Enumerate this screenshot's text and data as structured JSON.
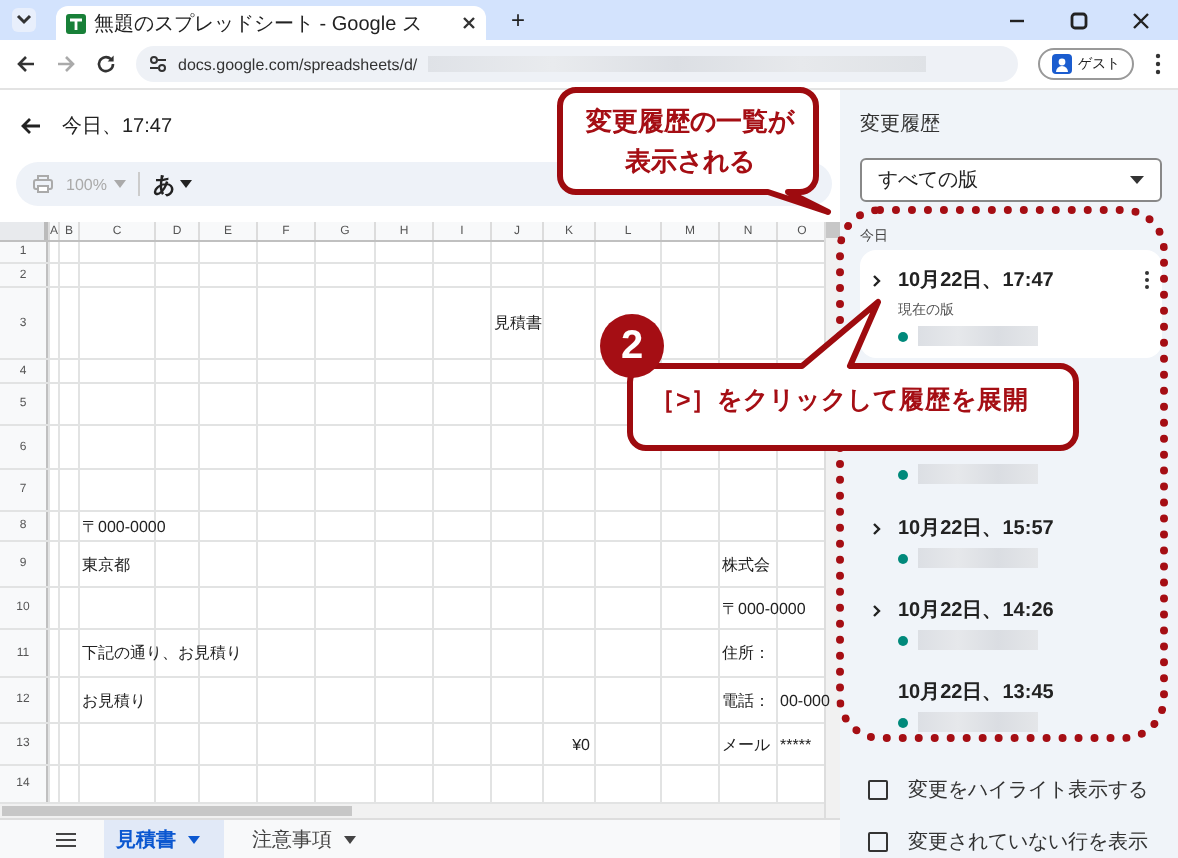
{
  "browser": {
    "tab_title": "無題のスプレッドシート - Google ス",
    "new_tab": "+",
    "url": "docs.google.com/spreadsheets/d/",
    "profile": "ゲスト"
  },
  "header": {
    "title": "今日、17:47"
  },
  "toolbar": {
    "zoom": "100%",
    "zoom_disabled": true,
    "input_mode": "あ"
  },
  "columns": [
    "A",
    "B",
    "C",
    "D",
    "E",
    "F",
    "G",
    "H",
    "I",
    "J",
    "K",
    "L",
    "M",
    "N",
    "O"
  ],
  "rows": [
    {
      "number": "1"
    },
    {
      "number": "2"
    },
    {
      "number": "3",
      "j": "見積書"
    },
    {
      "number": "4"
    },
    {
      "number": "5"
    },
    {
      "number": "6"
    },
    {
      "number": "7"
    },
    {
      "number": "8",
      "c": "〒000-0000"
    },
    {
      "number": "9",
      "c": "東京都",
      "n": "株式会"
    },
    {
      "number": "10",
      "n": "〒000-0000"
    },
    {
      "number": "11",
      "c": "下記の通り、お見積り",
      "n": "住所："
    },
    {
      "number": "12",
      "c": "お見積り",
      "n": "電話：",
      "o": "00-000"
    },
    {
      "number": "13",
      "k": "¥0",
      "n": "メール",
      "o": "*****"
    },
    {
      "number": "14"
    }
  ],
  "sheet_tabs": [
    {
      "label": "見積書",
      "selected": true
    },
    {
      "label": "注意事項",
      "selected": false
    }
  ],
  "history_panel": {
    "title": "変更履歴",
    "filter": "すべての版",
    "section": "今日",
    "versions": [
      {
        "date": "10月22日、17:47",
        "note": "現在の版",
        "expandable": true,
        "selected": true
      },
      {
        "selected": false
      },
      {
        "date": "10月22日、15:57",
        "expandable": true,
        "selected": false
      },
      {
        "date": "10月22日、14:26",
        "expandable": true,
        "selected": false
      },
      {
        "date": "10月22日、13:45",
        "expandable": false,
        "selected": false
      }
    ],
    "options": [
      {
        "label": "変更をハイライト表示する",
        "checked": false
      },
      {
        "label": "変更されていない行を表示",
        "checked": false
      }
    ]
  },
  "annotations": {
    "callout_1": "変更履歴の一覧が表示される",
    "step": "2",
    "callout_2": "［>］をクリックして履歴を展開"
  }
}
